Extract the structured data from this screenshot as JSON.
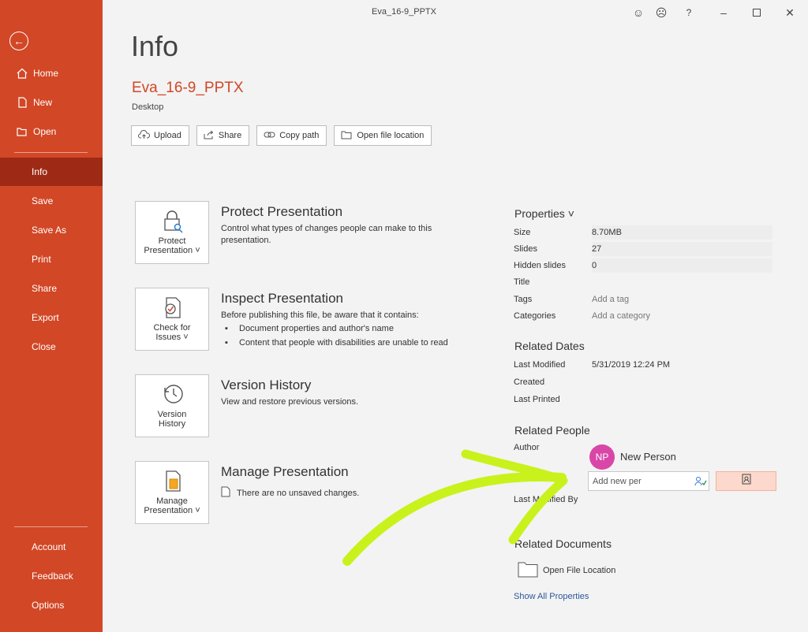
{
  "window": {
    "title": "Eva_16-9_PPTX"
  },
  "sidebar": {
    "top_items": [
      {
        "label": "Home",
        "icon": "home-icon"
      },
      {
        "label": "New",
        "icon": "new-doc-icon"
      },
      {
        "label": "Open",
        "icon": "folder-open-icon"
      }
    ],
    "items": [
      "Info",
      "Save",
      "Save As",
      "Print",
      "Share",
      "Export",
      "Close"
    ],
    "bottom_items": [
      "Account",
      "Feedback",
      "Options"
    ],
    "active": "Info"
  },
  "header": {
    "page_title": "Info",
    "file_name": "Eva_16-9_PPTX",
    "location": "Desktop",
    "buttons": [
      "Upload",
      "Share",
      "Copy path",
      "Open file location"
    ]
  },
  "sections": [
    {
      "tile_label_1": "Protect",
      "tile_label_2": "Presentation ˅",
      "heading": "Protect Presentation",
      "text": "Control what types of changes people can make to this presentation."
    },
    {
      "tile_label_1": "Check for",
      "tile_label_2": "Issues ˅",
      "heading": "Inspect Presentation",
      "text": "Before publishing this file, be aware that it contains:",
      "bullets": [
        "Document properties and author's name",
        "Content that people with disabilities are unable to read"
      ]
    },
    {
      "tile_label_1": "Version",
      "tile_label_2": "History",
      "heading": "Version History",
      "text": "View and restore previous versions."
    },
    {
      "tile_label_1": "Manage",
      "tile_label_2": "Presentation ˅",
      "heading": "Manage Presentation",
      "text": "There are no unsaved changes."
    }
  ],
  "properties": {
    "heading": "Properties ˅",
    "rows": [
      {
        "key": "Size",
        "value": "8.70MB"
      },
      {
        "key": "Slides",
        "value": "27"
      },
      {
        "key": "Hidden slides",
        "value": "0"
      },
      {
        "key": "Title",
        "value": ""
      },
      {
        "key": "Tags",
        "value": "Add a tag"
      },
      {
        "key": "Categories",
        "value": "Add a category"
      }
    ]
  },
  "related_dates": {
    "heading": "Related Dates",
    "rows": [
      {
        "key": "Last Modified",
        "value": "5/31/2019 12:24 PM"
      },
      {
        "key": "Created",
        "value": ""
      },
      {
        "key": "Last Printed",
        "value": ""
      }
    ]
  },
  "related_people": {
    "heading": "Related People",
    "author_label": "Author",
    "author_initials": "NP",
    "author_name": "New Person",
    "add_person_value": "Add new per",
    "last_modified_by_label": "Last Modified By"
  },
  "related_documents": {
    "heading": "Related Documents",
    "open_location": "Open File Location",
    "show_all": "Show All Properties"
  },
  "colors": {
    "accent": "#d24726",
    "active": "#9e2a15",
    "annotation": "#c9f21c"
  }
}
